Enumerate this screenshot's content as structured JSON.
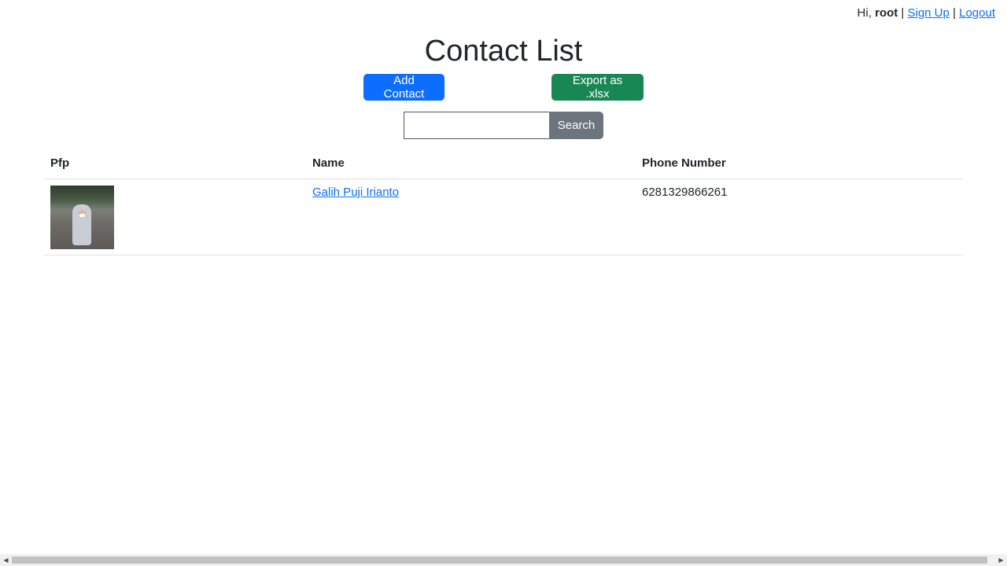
{
  "userbar": {
    "greeting": "Hi,",
    "username": "root",
    "separator1": "|",
    "signup_label": "Sign Up",
    "separator2": "|",
    "logout_label": "Logout"
  },
  "page_title": "Contact List",
  "actions": {
    "add_label": "Add Contact",
    "export_label": "Export as .xlsx"
  },
  "search": {
    "value": "",
    "button_label": "Search"
  },
  "table": {
    "columns": [
      "Pfp",
      "Name",
      "Phone Number"
    ],
    "rows": [
      {
        "name": "Galih Puji Irianto",
        "phone": "6281329866261"
      }
    ]
  },
  "scrollbar": {
    "left_arrow": "◀",
    "right_arrow": "▶"
  }
}
